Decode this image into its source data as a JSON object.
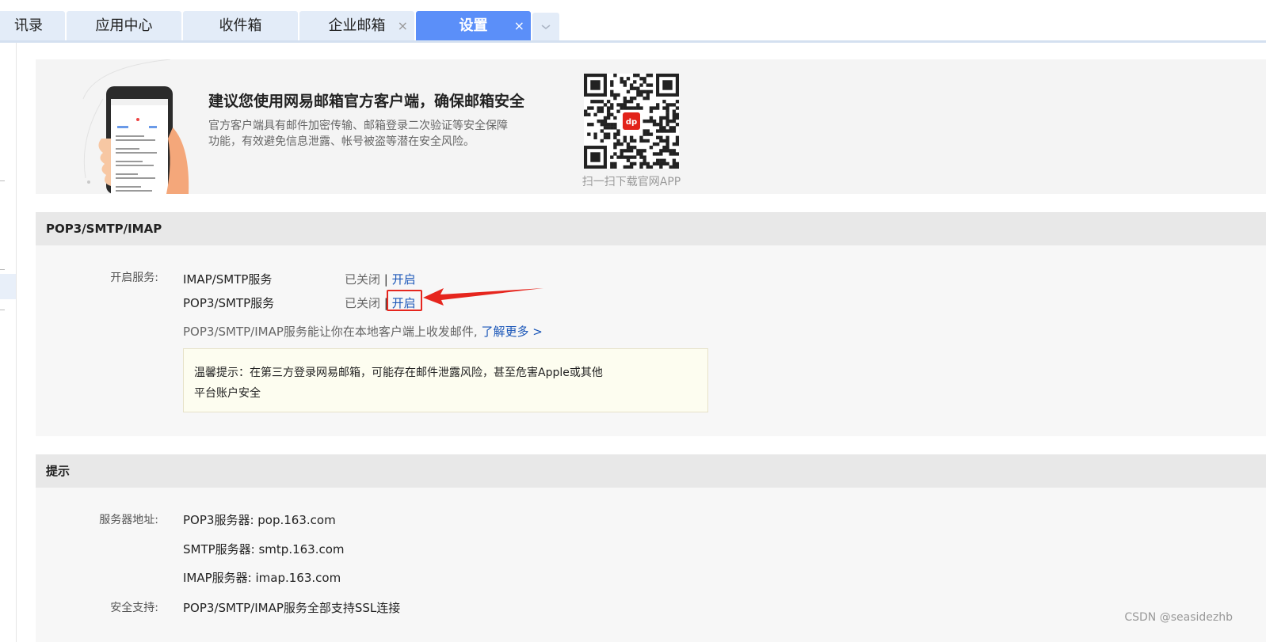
{
  "tabs": [
    {
      "label": "讯录",
      "closable": false,
      "active": false
    },
    {
      "label": "应用中心",
      "closable": false,
      "active": false
    },
    {
      "label": "收件箱",
      "closable": false,
      "active": false
    },
    {
      "label": "企业邮箱",
      "closable": true,
      "active": false
    },
    {
      "label": "设置",
      "closable": true,
      "active": true
    }
  ],
  "close_glyph": "×",
  "banner": {
    "title": "建议您使用网易邮箱官方客户端，确保邮箱安全",
    "desc": "官方客户端具有邮件加密传输、邮箱登录二次验证等安全保障功能，有效避免信息泄露、帐号被盗等潜在安全风险。",
    "qr_caption": "扫一扫下载官网APP",
    "qr_logo": "dp"
  },
  "pop3_section": {
    "title": "POP3/SMTP/IMAP",
    "label": "开启服务:",
    "services": [
      {
        "name": "IMAP/SMTP服务",
        "status": "已关闭",
        "sep": "|",
        "action": "开启"
      },
      {
        "name": "POP3/SMTP服务",
        "status": "已关闭",
        "sep": "|",
        "action": "开启"
      }
    ],
    "note": "POP3/SMTP/IMAP服务能让你在本地客户端上收发邮件,",
    "learn_more": "了解更多 >",
    "tip_line1": "温馨提示：在第三方登录网易邮箱，可能存在邮件泄露风险，甚至危害Apple或其他",
    "tip_line2": "平台账户安全"
  },
  "hint_section": {
    "title": "提示",
    "server_label": "服务器地址:",
    "servers": [
      "POP3服务器: pop.163.com",
      "SMTP服务器: smtp.163.com",
      "IMAP服务器: imap.163.com"
    ],
    "security_label": "安全支持:",
    "security_value": "POP3/SMTP/IMAP服务全部支持SSL连接"
  },
  "watermark": "CSDN @seasidezhb",
  "colors": {
    "active_tab": "#5b8ff9",
    "link": "#1a56b8",
    "annotation": "#e6261e"
  }
}
